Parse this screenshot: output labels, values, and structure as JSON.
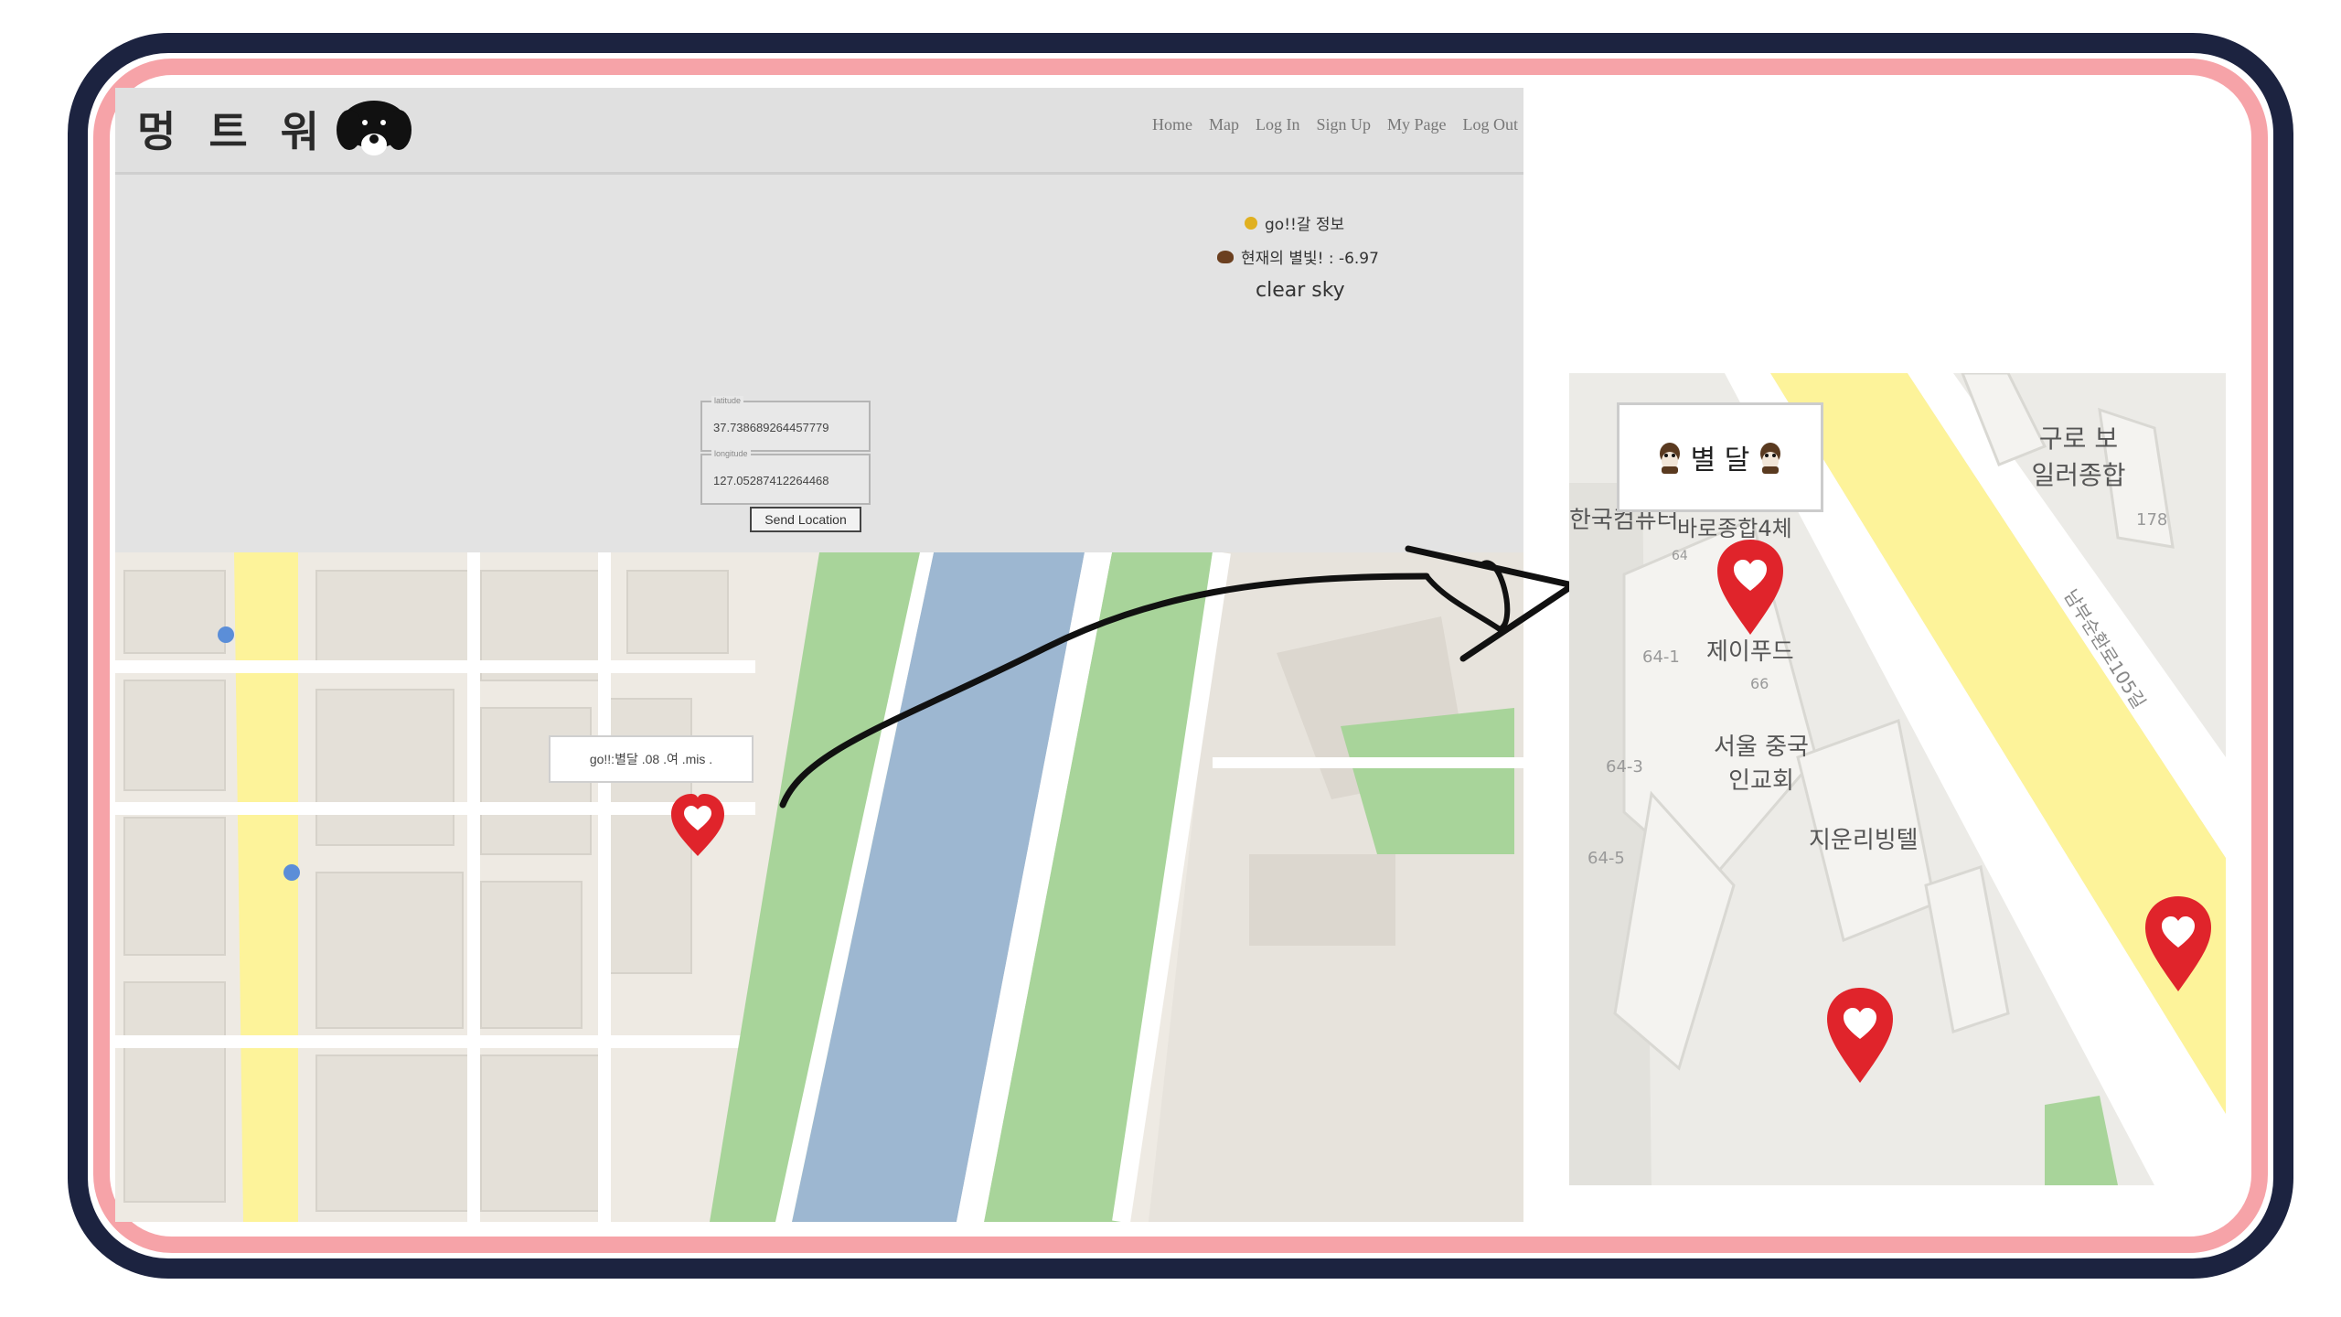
{
  "site": {
    "logo": "멍 트 워 크",
    "nav": [
      "Home",
      "Map",
      "Log In",
      "Sign Up",
      "My Page",
      "Log Out"
    ],
    "weather": {
      "line1": "go!!갈 정보",
      "line2": "현재의 별빛! : -6.97",
      "description": "clear sky"
    },
    "latitude": {
      "label": "latitude",
      "value": "37.738689264457779"
    },
    "longitude": {
      "label": "longitude",
      "value": "127.05287412264468"
    },
    "send_button": "Send Location",
    "marker_popup": "go!!:별달 .08 .여 .mis ."
  },
  "zoom_map": {
    "popup": "별 달",
    "labels": [
      "한국컴퓨터",
      "바로종합4체",
      "제이푸드",
      "서울 중국인교회",
      "지운리빙텔",
      "구로 보일러종합",
      "남부순환로105길",
      "64-1",
      "64-3",
      "64-5",
      "66",
      "178",
      "64"
    ]
  },
  "colors": {
    "frame_outer": "#1c2340",
    "frame_inner": "#f6a3a8",
    "marker": "#e0242b",
    "river": "#9db7d1",
    "park": "#a8d49a",
    "road_yellow": "#fdf39a"
  }
}
